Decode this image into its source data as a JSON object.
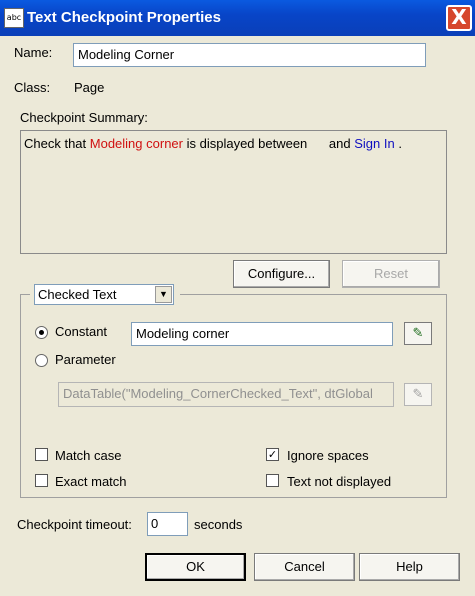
{
  "window": {
    "title": "Text Checkpoint Properties",
    "icon_text": "abc",
    "close_glyph": "X"
  },
  "name_field": {
    "label": "Name:",
    "value": "Modeling Corner"
  },
  "class_field": {
    "label": "Class:",
    "value": "Page"
  },
  "summary": {
    "label": "Checkpoint Summary:",
    "prefix": "Check that ",
    "checked_text": "Modeling corner",
    "middle": " is displayed between ",
    "and_text": "and",
    "after_text": "Sign In",
    "suffix": " ."
  },
  "buttons": {
    "configure": "Configure...",
    "reset": "Reset",
    "ok": "OK",
    "cancel": "Cancel",
    "help": "Help"
  },
  "text_selector": {
    "selected": "Checked Text"
  },
  "value_source": {
    "constant_label": "Constant",
    "constant_value": "Modeling corner",
    "parameter_label": "Parameter",
    "parameter_value": "DataTable(\"Modeling_CornerChecked_Text\", dtGlobal"
  },
  "options": {
    "match_case": {
      "label": "Match case",
      "checked": false
    },
    "ignore_spaces": {
      "label": "Ignore spaces",
      "checked": true
    },
    "exact_match": {
      "label": "Exact match",
      "checked": false
    },
    "text_not_displayed": {
      "label": "Text not displayed",
      "checked": false
    }
  },
  "timeout": {
    "label": "Checkpoint timeout:",
    "value": "0",
    "unit": "seconds"
  },
  "icons": {
    "edit": "edit-parameter-icon",
    "dropdown": "chevron-down-icon"
  },
  "colors": {
    "title_bar": "#0845c8",
    "checked_text": "#d01010",
    "after_text": "#1010c0",
    "dialog_bg": "#ece9d8"
  }
}
